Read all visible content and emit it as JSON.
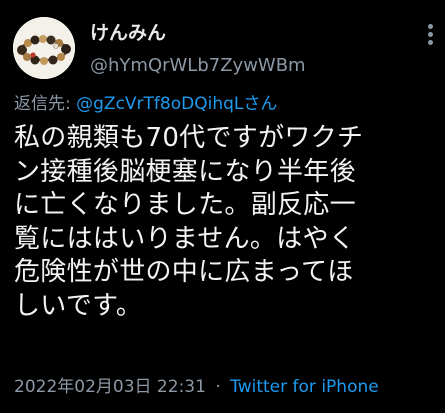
{
  "author": {
    "display_name": "けんみん",
    "handle": "@hYmQrWLb7ZywWBm"
  },
  "reply_to": {
    "prefix": "返信先: ",
    "mention": "@gZcVrTf8oDQihqL",
    "suffix": "さん"
  },
  "body_lines": [
    "私の親類も70代ですがワクチ",
    "ン接種後脳梗塞になり半年後",
    "に亡くなりました。副反応一",
    "覧にははいりません。はやく",
    "危険性が世の中に広まってほ",
    "しいです。"
  ],
  "meta": {
    "timestamp": "2022年02月03日 22:31",
    "separator": "·",
    "client": "Twitter for iPhone"
  },
  "icons": {
    "avatar": "beaded-bracelet-avatar",
    "more": "more-options-icon"
  },
  "colors": {
    "background": "#000000",
    "text": "#e7e9ea",
    "secondary": "#8b98a5",
    "accent": "#1d9bf0"
  }
}
